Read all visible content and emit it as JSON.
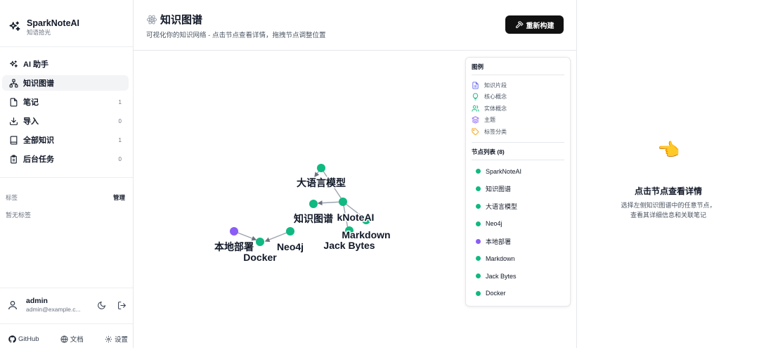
{
  "brand": {
    "title": "SparkNoteAI",
    "subtitle": "知语拾光"
  },
  "nav": [
    {
      "label": "AI 助手",
      "icon": "sparkles-icon",
      "count": ""
    },
    {
      "label": "知识图谱",
      "icon": "network-icon",
      "count": "",
      "active": true
    },
    {
      "label": "笔记",
      "icon": "file-icon",
      "count": "1"
    },
    {
      "label": "导入",
      "icon": "download-icon",
      "count": "0"
    },
    {
      "label": "全部知识",
      "icon": "book-icon",
      "count": "1"
    },
    {
      "label": "后台任务",
      "icon": "clipboard-icon",
      "count": "0"
    }
  ],
  "tags": {
    "heading": "标签",
    "manage": "管理",
    "empty": "暂无标签"
  },
  "user": {
    "name": "admin",
    "email": "admin@example.c..."
  },
  "footer": {
    "github": "GitHub",
    "docs": "文档",
    "settings": "设置"
  },
  "header": {
    "title": "知识图谱",
    "subtitle": "可视化你的知识网络 - 点击节点查看详情，拖拽节点调整位置",
    "rebuild_label": "重新构建"
  },
  "legend": {
    "title": "图例",
    "items": [
      {
        "label": "知识片段",
        "icon": "file-text-icon",
        "color": "#6366f1"
      },
      {
        "label": "核心概念",
        "icon": "lightbulb-icon",
        "color": "#10b981"
      },
      {
        "label": "实体概念",
        "icon": "users-icon",
        "color": "#10b981"
      },
      {
        "label": "主题",
        "icon": "layers-icon",
        "color": "#8b5cf6"
      },
      {
        "label": "标签分类",
        "icon": "tag-icon",
        "color": "#f59e0b"
      }
    ],
    "node_list_title": "节点列表 (8)",
    "nodes": [
      {
        "label": "SparkNoteAI",
        "color": "#10b981"
      },
      {
        "label": "知识图谱",
        "color": "#10b981"
      },
      {
        "label": "大语言模型",
        "color": "#10b981"
      },
      {
        "label": "Neo4j",
        "color": "#10b981"
      },
      {
        "label": "本地部署",
        "color": "#8b5cf6"
      },
      {
        "label": "Markdown",
        "color": "#10b981"
      },
      {
        "label": "Jack Bytes",
        "color": "#10b981"
      },
      {
        "label": "Docker",
        "color": "#10b981"
      }
    ]
  },
  "graph": {
    "labels": {
      "llm": "大语言模型",
      "kg": "知识图谱",
      "spark": "kNoteAI",
      "markdown": "Markdown",
      "jack": "Jack Bytes",
      "local": "本地部署",
      "neo4j": "Neo4j",
      "docker": "Docker"
    }
  },
  "detail": {
    "hand": "👈",
    "title": "点击节点查看详情",
    "line1": "选择左侧知识图谱中的任意节点，",
    "line2": "查看其详细信息和关联笔记"
  }
}
